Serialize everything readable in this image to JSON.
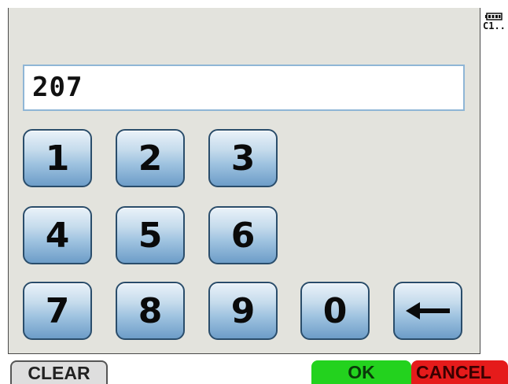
{
  "display": {
    "value": "207"
  },
  "keypad": {
    "k1": "1",
    "k2": "2",
    "k3": "3",
    "k4": "4",
    "k5": "5",
    "k6": "6",
    "k7": "7",
    "k8": "8",
    "k9": "9",
    "k0": "0",
    "backspace_icon": "left-arrow-icon"
  },
  "status": {
    "battery_icon": "battery-icon",
    "channel_text": "C1.."
  },
  "bottom_bar": {
    "clear_label": "CLEAR",
    "ok_label": "OK",
    "cancel_label": "CANCEL"
  },
  "colors": {
    "ok": "#23d21e",
    "cancel": "#e51b1b",
    "key_border": "#2a4d6b",
    "display_border": "#8fb6d6"
  }
}
